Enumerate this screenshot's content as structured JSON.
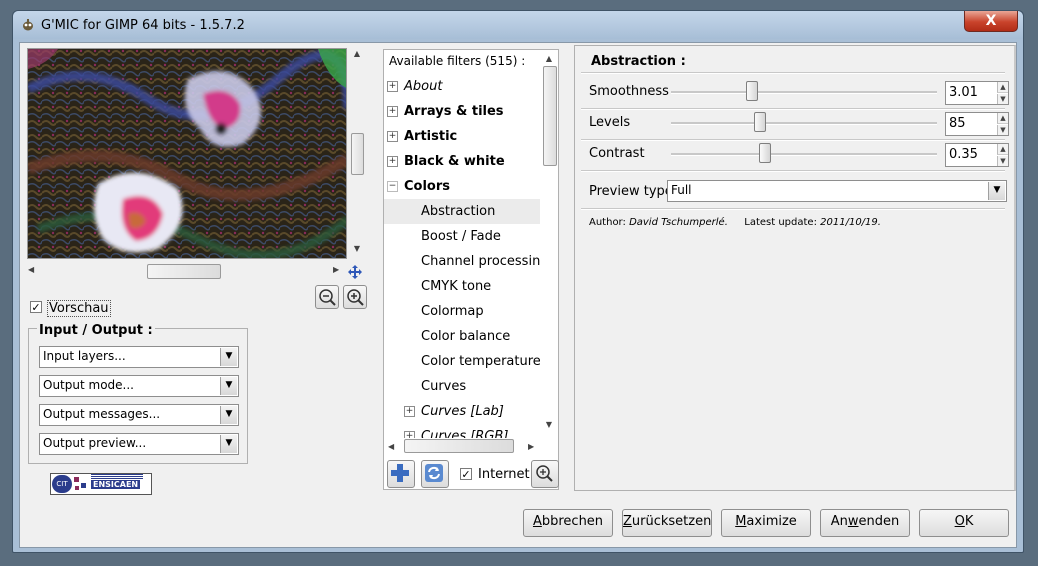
{
  "window": {
    "title": "G'MIC for GIMP 64 bits - 1.5.7.2",
    "close_glyph": "X"
  },
  "preview": {
    "checkbox_label": "Vorschau",
    "checked": true
  },
  "input_output": {
    "title": "Input / Output :",
    "combos": [
      {
        "label": "Input layers..."
      },
      {
        "label": "Output mode..."
      },
      {
        "label": "Output messages..."
      },
      {
        "label": "Output preview..."
      }
    ]
  },
  "logo": {
    "text": "ENSICAEN",
    "badge": "CIT"
  },
  "filters": {
    "header": "Available filters (515) :",
    "items": [
      {
        "label": "About",
        "style": "italic",
        "level": 0,
        "expander": "+"
      },
      {
        "label": "Arrays & tiles",
        "style": "bold",
        "level": 0,
        "expander": "+"
      },
      {
        "label": "Artistic",
        "style": "bold",
        "level": 0,
        "expander": "+"
      },
      {
        "label": "Black & white",
        "style": "bold",
        "level": 0,
        "expander": "+"
      },
      {
        "label": "Colors",
        "style": "bold",
        "level": 0,
        "expander": "−"
      },
      {
        "label": "Abstraction",
        "style": "normal",
        "level": 1,
        "selected": true
      },
      {
        "label": "Boost / Fade",
        "style": "normal",
        "level": 1
      },
      {
        "label": "Channel processing",
        "style": "normal",
        "level": 1
      },
      {
        "label": "CMYK tone",
        "style": "normal",
        "level": 1
      },
      {
        "label": "Colormap",
        "style": "normal",
        "level": 1
      },
      {
        "label": "Color balance",
        "style": "normal",
        "level": 1
      },
      {
        "label": "Color temperature",
        "style": "normal",
        "level": 1
      },
      {
        "label": "Curves",
        "style": "normal",
        "level": 1
      },
      {
        "label": "Curves [Lab]",
        "style": "italic",
        "level": 1,
        "expander": "+"
      },
      {
        "label": "Curves [RGB]",
        "style": "italic",
        "level": 1,
        "expander": "+"
      }
    ],
    "internet_label": "Internet",
    "internet_checked": true
  },
  "params": {
    "title": "Abstraction :",
    "sliders": [
      {
        "label": "Smoothness",
        "value": "3.01",
        "fraction": 0.3
      },
      {
        "label": "Levels",
        "value": "85",
        "fraction": 0.33
      },
      {
        "label": "Contrast",
        "value": "0.35",
        "fraction": 0.35
      }
    ],
    "preview_type_label": "Preview type",
    "preview_type_value": "Full",
    "author_label": "Author:",
    "author_value": "David Tschumperlé.",
    "update_label": "Latest update:",
    "update_value": "2011/10/19."
  },
  "buttons": {
    "cancel": {
      "pre": "",
      "key": "A",
      "post": "bbrechen"
    },
    "reset": {
      "pre": "",
      "key": "Z",
      "post": "urücksetzen"
    },
    "maximize": {
      "pre": "",
      "key": "M",
      "post": "aximize"
    },
    "apply": {
      "pre": "An",
      "key": "w",
      "post": "enden"
    },
    "ok": {
      "pre": "",
      "key": "O",
      "post": "K"
    }
  },
  "colors": {
    "accent": "#3a5ba8",
    "selection": "#ececec",
    "close_red": "#c9432b"
  }
}
